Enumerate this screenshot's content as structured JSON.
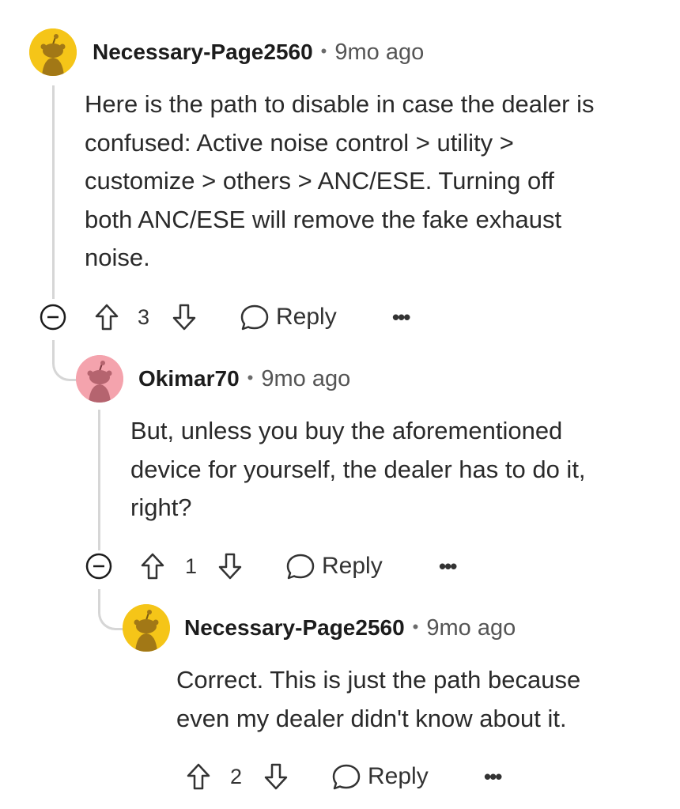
{
  "comments": [
    {
      "username": "Necessary-Page2560",
      "separator": "•",
      "time": "9mo ago",
      "avatar_icon": "snoo-avatar-icon",
      "avatar_color": "#f5c518",
      "body_lines": [
        "Here is the path to disable in case the dealer is",
        "confused: Active noise control > utility >",
        "customize > others > ANC/ESE. Turning off",
        "both ANC/ESE will remove the fake exhaust",
        "noise."
      ],
      "votes": "3",
      "reply_label": "Reply",
      "more_label": "•••"
    },
    {
      "username": "Okimar70",
      "separator": "•",
      "time": "9mo ago",
      "avatar_icon": "snoo-avatar-icon",
      "avatar_color": "#f4a3ad",
      "body_lines": [
        "But, unless you buy the aforementioned",
        "device for yourself, the dealer has to do it,",
        "right?"
      ],
      "votes": "1",
      "reply_label": "Reply",
      "more_label": "•••"
    },
    {
      "username": "Necessary-Page2560",
      "separator": "•",
      "time": "9mo ago",
      "avatar_icon": "snoo-avatar-icon",
      "avatar_color": "#f5c518",
      "body_lines": [
        "Correct. This is just the path because",
        "even my dealer didn't know about it."
      ],
      "votes": "2",
      "reply_label": "Reply",
      "more_label": "•••"
    }
  ],
  "colors": {
    "thread_line": "#d6d6d6",
    "text": "#2a2a2a",
    "muted": "#555555"
  }
}
